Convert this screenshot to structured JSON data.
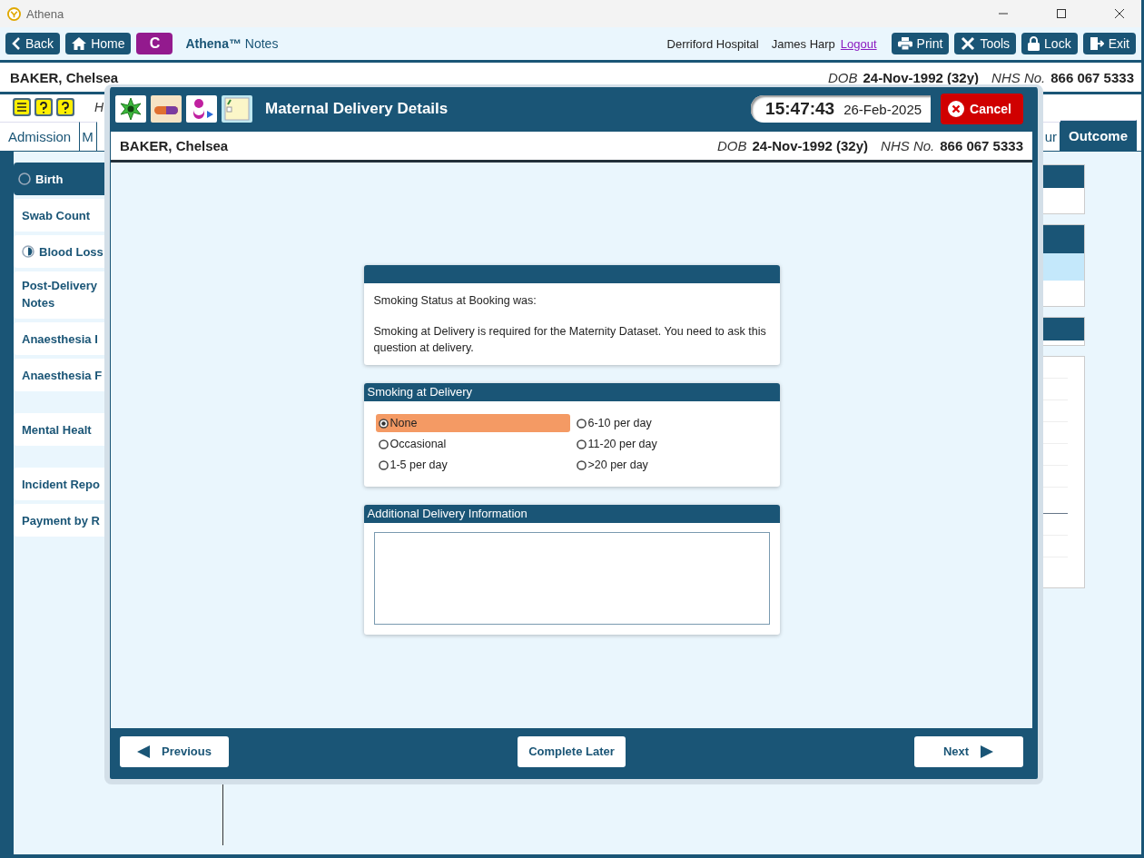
{
  "window": {
    "title": "Athena"
  },
  "toolbar": {
    "nav": [
      {
        "label": "Back"
      },
      {
        "label": "Home"
      }
    ],
    "badge": "C",
    "app_name": "**Athena™** Notes",
    "hospital": "Derriford Hospital",
    "user": "James Harp",
    "logout": "Logout",
    "actions": [
      {
        "label": "Print"
      },
      {
        "label": "Tools"
      },
      {
        "label": "Lock"
      },
      {
        "label": "Exit"
      }
    ]
  },
  "patient": {
    "name": "BAKER, Chelsea",
    "dob_label": "DOB",
    "dob": "24-Nov-1992 (32y)",
    "nhs_label": "NHS No.",
    "nhs": "866 067 5333"
  },
  "alert_text": "H",
  "tabs": [
    {
      "label": "Admission",
      "selected": false
    },
    {
      "label": "M",
      "selected": false
    },
    {
      "label": "ur",
      "selected": false
    },
    {
      "label": "Outcome",
      "selected": true
    }
  ],
  "sidebar": [
    {
      "items": [
        {
          "label": "Birth",
          "selected": true,
          "kind": "empty"
        },
        {
          "label": "Swab Count",
          "selected": false
        },
        {
          "label": "Blood Loss",
          "selected": false,
          "kind": "half"
        },
        {
          "label": "Post-Delivery Notes",
          "selected": false
        },
        {
          "label": "Anaesthesia I",
          "selected": false
        },
        {
          "label": "Anaesthesia F",
          "selected": false
        }
      ]
    },
    {
      "items": [
        {
          "label": "Mental Healt",
          "selected": false
        }
      ]
    },
    {
      "items": [
        {
          "label": "Incident Repo",
          "selected": false
        },
        {
          "label": "Payment by R",
          "selected": false
        }
      ]
    }
  ],
  "modal": {
    "title": "Maternal Delivery Details",
    "time": "15:47:43",
    "date": "26-Feb-2025",
    "cancel": "Cancel",
    "patient": {
      "name": "BAKER, Chelsea",
      "dob_label": "DOB",
      "dob": "24-Nov-1992 (32y)",
      "nhs_label": "NHS No.",
      "nhs": "866 067 5333"
    },
    "notice": [
      "Smoking Status at Booking was:",
      "Smoking at Delivery is required for the Maternity Dataset. You need to ask this question at delivery."
    ],
    "smoking": {
      "title": "Smoking at Delivery",
      "options": [
        {
          "label": "None",
          "selected": true
        },
        {
          "label": "Occasional",
          "selected": false
        },
        {
          "label": "1-5 per day",
          "selected": false
        },
        {
          "label": "6-10 per day",
          "selected": false
        },
        {
          "label": "11-20 per day",
          "selected": false
        },
        {
          "label": ">20 per day",
          "selected": false
        }
      ]
    },
    "additional": {
      "title": "Additional Delivery Information"
    },
    "footer": {
      "previous": "Previous",
      "complete_later": "Complete Later",
      "next": "Next"
    }
  }
}
